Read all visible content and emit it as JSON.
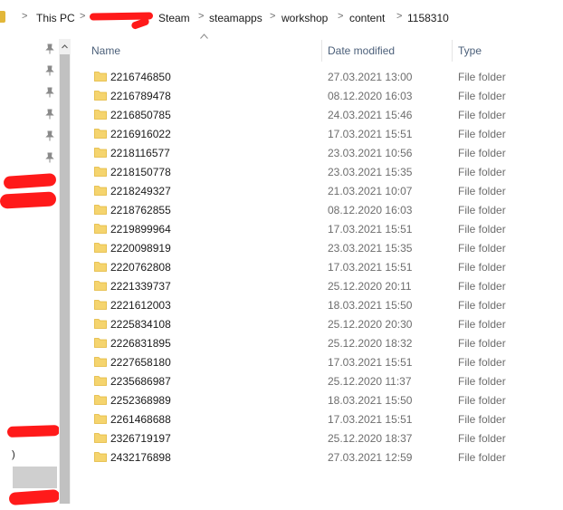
{
  "breadcrumb": {
    "items": [
      "This PC",
      "Steam",
      "steamapps",
      "workshop",
      "content",
      "1158310"
    ],
    "separator": ">"
  },
  "nav": {
    "partial_text": ")"
  },
  "columns": {
    "name": "Name",
    "date": "Date modified",
    "type": "Type"
  },
  "rows": [
    {
      "name": "2216746850",
      "date": "27.03.2021 13:00",
      "type": "File folder"
    },
    {
      "name": "2216789478",
      "date": "08.12.2020 16:03",
      "type": "File folder"
    },
    {
      "name": "2216850785",
      "date": "24.03.2021 15:46",
      "type": "File folder"
    },
    {
      "name": "2216916022",
      "date": "17.03.2021 15:51",
      "type": "File folder"
    },
    {
      "name": "2218116577",
      "date": "23.03.2021 10:56",
      "type": "File folder"
    },
    {
      "name": "2218150778",
      "date": "23.03.2021 15:35",
      "type": "File folder"
    },
    {
      "name": "2218249327",
      "date": "21.03.2021 10:07",
      "type": "File folder"
    },
    {
      "name": "2218762855",
      "date": "08.12.2020 16:03",
      "type": "File folder"
    },
    {
      "name": "2219899964",
      "date": "17.03.2021 15:51",
      "type": "File folder"
    },
    {
      "name": "2220098919",
      "date": "23.03.2021 15:35",
      "type": "File folder"
    },
    {
      "name": "2220762808",
      "date": "17.03.2021 15:51",
      "type": "File folder"
    },
    {
      "name": "2221339737",
      "date": "25.12.2020 20:11",
      "type": "File folder"
    },
    {
      "name": "2221612003",
      "date": "18.03.2021 15:50",
      "type": "File folder"
    },
    {
      "name": "2225834108",
      "date": "25.12.2020 20:30",
      "type": "File folder"
    },
    {
      "name": "2226831895",
      "date": "25.12.2020 18:32",
      "type": "File folder"
    },
    {
      "name": "2227658180",
      "date": "17.03.2021 15:51",
      "type": "File folder"
    },
    {
      "name": "2235686987",
      "date": "25.12.2020 11:37",
      "type": "File folder"
    },
    {
      "name": "2252368989",
      "date": "18.03.2021 15:50",
      "type": "File folder"
    },
    {
      "name": "2261468688",
      "date": "17.03.2021 15:51",
      "type": "File folder"
    },
    {
      "name": "2326719197",
      "date": "25.12.2020 18:37",
      "type": "File folder"
    },
    {
      "name": "2432176898",
      "date": "27.03.2021 12:59",
      "type": "File folder"
    }
  ],
  "colors": {
    "folder": "#f5d46e",
    "folder_tab": "#e2b73a",
    "redaction": "#ff1a1a",
    "header_text": "#4c607a"
  },
  "icons": {
    "pin": "pin-icon",
    "folder": "folder-icon",
    "sort": "sort-ascending-icon",
    "scroll_up": "scroll-up-icon"
  }
}
